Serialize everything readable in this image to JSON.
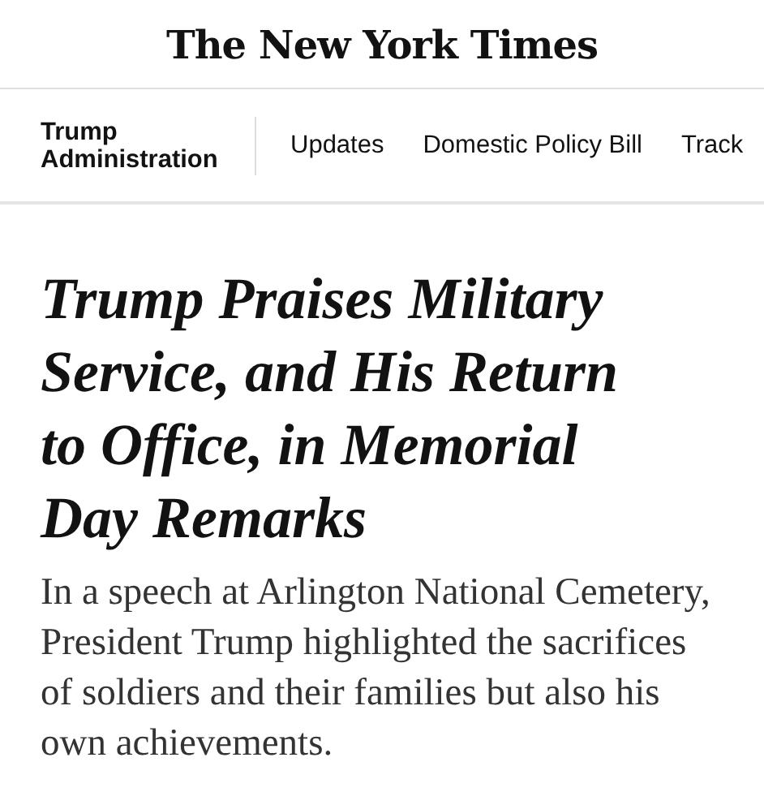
{
  "masthead": {
    "logo": "The New York Times"
  },
  "section_nav": {
    "section": "Trump Administration",
    "links": [
      "Updates",
      "Domestic Policy Bill",
      "Track"
    ]
  },
  "article": {
    "headline": "Trump Praises Military Service, and His Return to Office, in Memorial Day Remarks",
    "summary": "In a speech at Arlington National Cemetery, President Trump highlighted the sacrifices of soldiers and their families but also his own achievements."
  }
}
